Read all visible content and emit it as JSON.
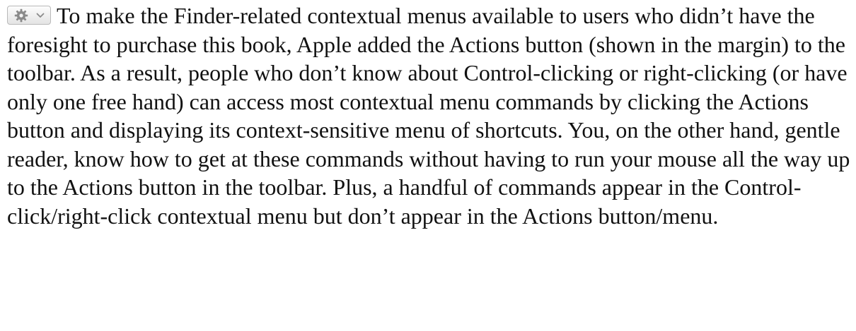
{
  "actions_button": {
    "icon": "gear-icon",
    "dropdown_icon": "chevron-down-icon",
    "icon_color": "#8a8a8a"
  },
  "paragraph": {
    "sentence_1": "To make the Finder-related contextual menus available to users who didn’t have the foresight to purchase this book, Apple added the Actions button (shown in the margin) to the toolbar.",
    "sentence_2": "As a result, people who don’t know about Control-clicking or right-clicking (or have only one free hand) can access most contextual menu commands by clicking the Actions button and displaying its context-sensitive menu of shortcuts.",
    "sentence_3": "You, on the other hand, gentle reader, know how to get at these commands without having to run your mouse all the way up to the Actions button in the toolbar.",
    "sentence_4": "Plus, a handful of commands appear in the Control-click/right-click contextual menu but don’t appear in the Actions button/menu."
  }
}
